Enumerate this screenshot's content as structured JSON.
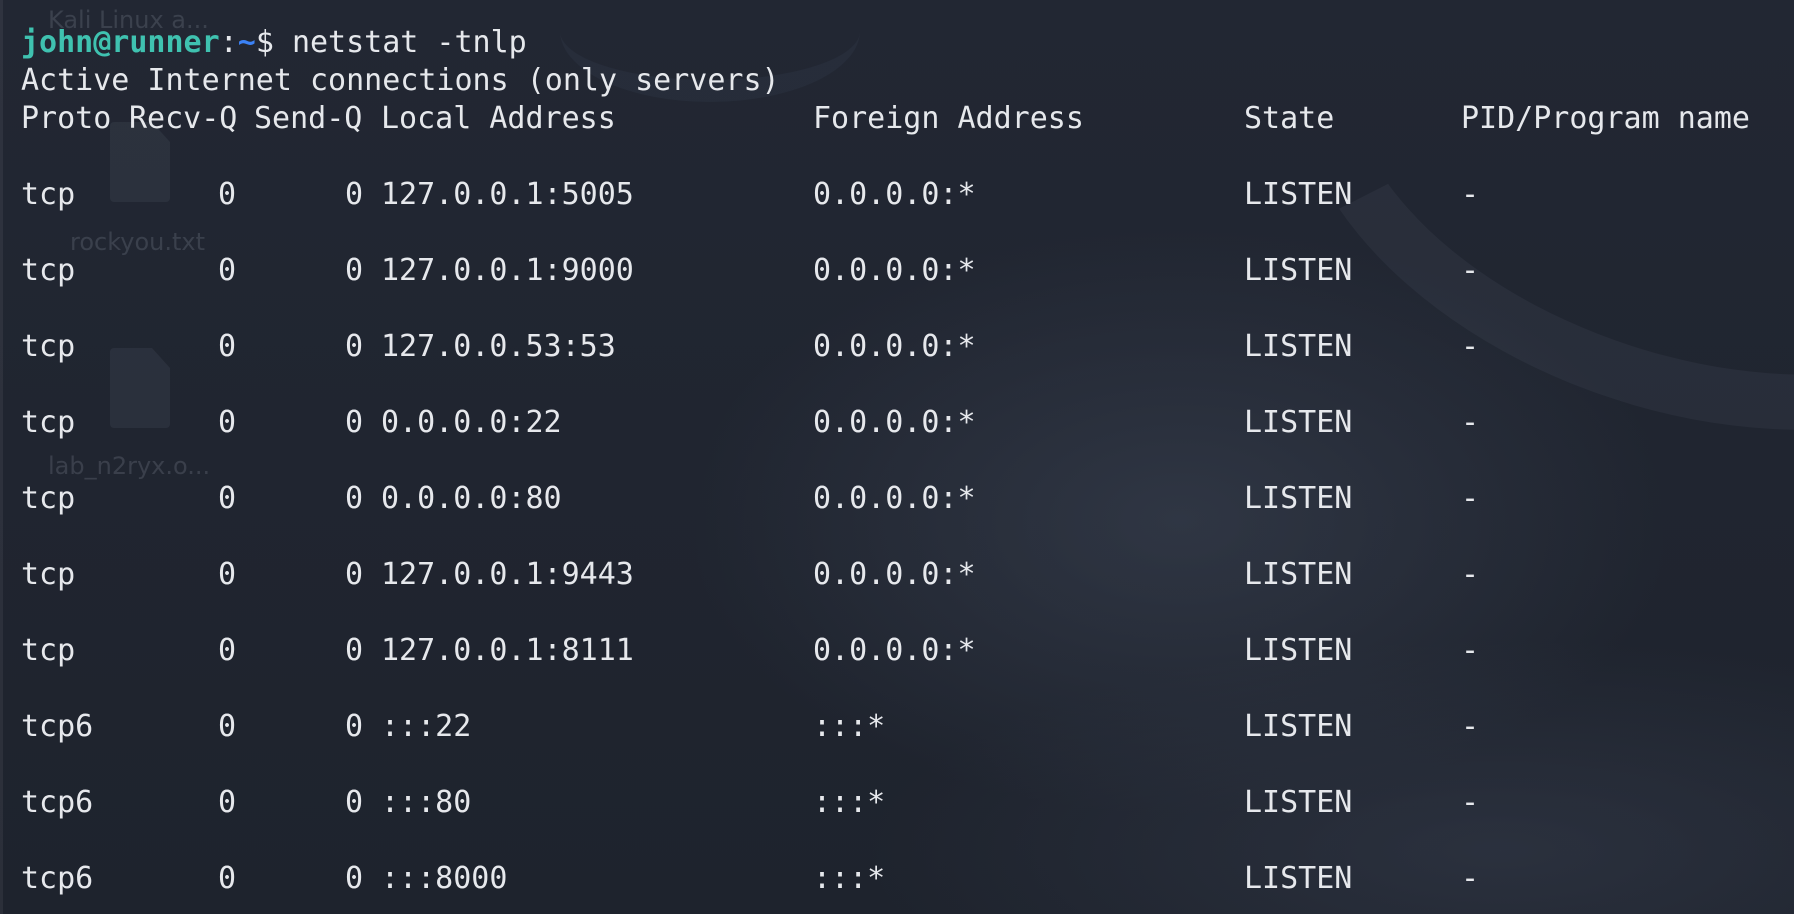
{
  "desktop": {
    "icons": [
      {
        "label": "Kali Linux a..."
      },
      {
        "label": "rockyou.txt"
      },
      {
        "label": "lab_n2ryx.o..."
      }
    ]
  },
  "terminal": {
    "prompt": {
      "user_host": "john@runner",
      "colon": ":",
      "path": "~",
      "symbol": "$ ",
      "command": "netstat -tnlp"
    },
    "summary": "Active Internet connections (only servers)",
    "headers": {
      "proto": "Proto",
      "recvq": "Recv-Q",
      "sendq": "Send-Q",
      "local": "Local Address",
      "foreign": "Foreign Address",
      "state": "State",
      "pid": "PID/Program name"
    },
    "rows": [
      {
        "proto": "tcp",
        "recvq": "0",
        "sendq": "0",
        "local": "127.0.0.1:5005",
        "foreign": "0.0.0.0:*",
        "state": "LISTEN",
        "pid": "-"
      },
      {
        "proto": "tcp",
        "recvq": "0",
        "sendq": "0",
        "local": "127.0.0.1:9000",
        "foreign": "0.0.0.0:*",
        "state": "LISTEN",
        "pid": "-"
      },
      {
        "proto": "tcp",
        "recvq": "0",
        "sendq": "0",
        "local": "127.0.0.53:53",
        "foreign": "0.0.0.0:*",
        "state": "LISTEN",
        "pid": "-"
      },
      {
        "proto": "tcp",
        "recvq": "0",
        "sendq": "0",
        "local": "0.0.0.0:22",
        "foreign": "0.0.0.0:*",
        "state": "LISTEN",
        "pid": "-"
      },
      {
        "proto": "tcp",
        "recvq": "0",
        "sendq": "0",
        "local": "0.0.0.0:80",
        "foreign": "0.0.0.0:*",
        "state": "LISTEN",
        "pid": "-"
      },
      {
        "proto": "tcp",
        "recvq": "0",
        "sendq": "0",
        "local": "127.0.0.1:9443",
        "foreign": "0.0.0.0:*",
        "state": "LISTEN",
        "pid": "-"
      },
      {
        "proto": "tcp",
        "recvq": "0",
        "sendq": "0",
        "local": "127.0.0.1:8111",
        "foreign": "0.0.0.0:*",
        "state": "LISTEN",
        "pid": "-"
      },
      {
        "proto": "tcp6",
        "recvq": "0",
        "sendq": "0",
        "local": ":::22",
        "foreign": ":::*",
        "state": "LISTEN",
        "pid": "-"
      },
      {
        "proto": "tcp6",
        "recvq": "0",
        "sendq": "0",
        "local": ":::80",
        "foreign": ":::*",
        "state": "LISTEN",
        "pid": "-"
      },
      {
        "proto": "tcp6",
        "recvq": "0",
        "sendq": "0",
        "local": ":::8000",
        "foreign": ":::*",
        "state": "LISTEN",
        "pid": "-"
      }
    ]
  },
  "colors": {
    "background": "#1f2430",
    "text": "#e6e8ec",
    "prompt_user": "#3fc2b0",
    "prompt_path": "#3b82f6"
  }
}
